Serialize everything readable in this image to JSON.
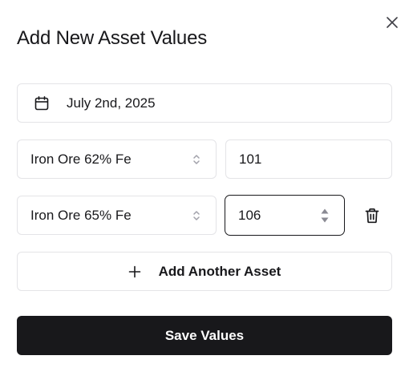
{
  "dialog": {
    "title": "Add New Asset Values"
  },
  "date_field": {
    "value": "July 2nd, 2025",
    "icon": "calendar-icon"
  },
  "rows": [
    {
      "asset": "Iron Ore 62% Fe",
      "value": "101"
    },
    {
      "asset": "Iron Ore 65% Fe",
      "value": "106"
    }
  ],
  "actions": {
    "add_label": "Add Another Asset",
    "save_label": "Save Values"
  },
  "icons": {
    "close": "close-icon",
    "select_chevron": "chevron-up-down-icon",
    "spinner": "spinner-arrows-icon",
    "trash": "trash-icon",
    "plus": "plus-icon"
  },
  "colors": {
    "primary": "#18181b",
    "border": "#e4e4e7",
    "background": "#ffffff"
  }
}
